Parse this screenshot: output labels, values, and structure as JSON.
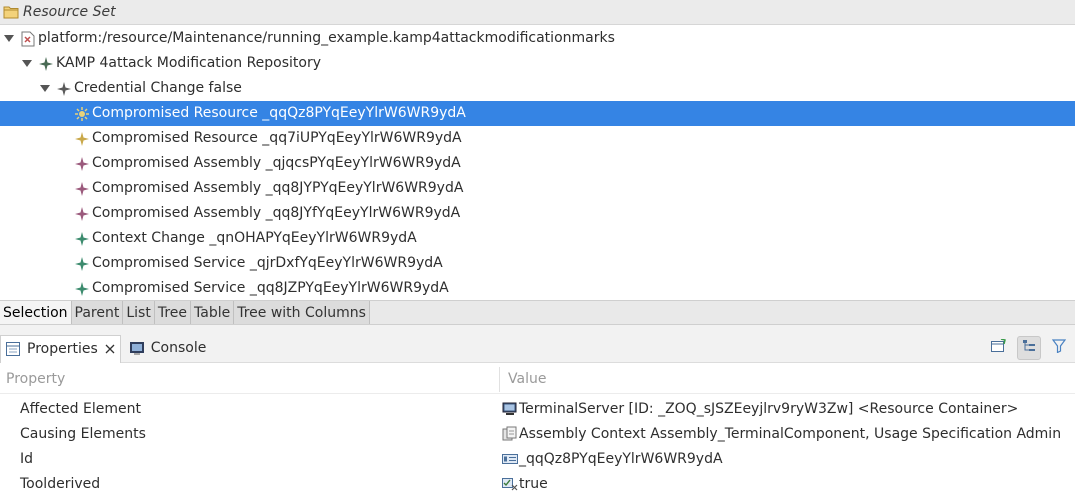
{
  "header": {
    "title": "Resource Set"
  },
  "tree": {
    "root": {
      "label": "platform:/resource/Maintenance/running_example.kamp4attackmodificationmarks"
    },
    "repository": {
      "label": "KAMP 4attack Modification Repository"
    },
    "change": {
      "label": "Credential Change false"
    },
    "items": [
      {
        "label": "Compromised Resource _qqQz8PYqEeyYlrW6WR9ydA",
        "icon": "gear-icon",
        "color": "#c9a84a"
      },
      {
        "label": "Compromised Resource _qq7iUPYqEeyYlrW6WR9ydA",
        "icon": "sparkle-icon",
        "color": "#c9a84a"
      },
      {
        "label": "Compromised Assembly _qjqcsPYqEeyYlrW6WR9ydA",
        "icon": "sparkle-icon",
        "color": "#9b5a7c"
      },
      {
        "label": "Compromised Assembly _qq8JYPYqEeyYlrW6WR9ydA",
        "icon": "sparkle-icon",
        "color": "#9b5a7c"
      },
      {
        "label": "Compromised Assembly _qq8JYfYqEeyYlrW6WR9ydA",
        "icon": "sparkle-icon",
        "color": "#9b5a7c"
      },
      {
        "label": "Context Change _qnOHAPYqEeyYlrW6WR9ydA",
        "icon": "sparkle-icon",
        "color": "#3d8b6e"
      },
      {
        "label": "Compromised Service _qjrDxfYqEeyYlrW6WR9ydA",
        "icon": "sparkle-icon",
        "color": "#3d8b6e"
      },
      {
        "label": "Compromised Service _qq8JZPYqEeyYlrW6WR9ydA",
        "icon": "sparkle-icon",
        "color": "#3d8b6e"
      }
    ]
  },
  "editor_tabs": [
    "Selection",
    "Parent",
    "List",
    "Tree",
    "Table",
    "Tree with Columns"
  ],
  "views": {
    "properties": "Properties",
    "console": "Console"
  },
  "properties": {
    "col_property": "Property",
    "col_value": "Value",
    "rows": [
      {
        "name": "Affected Element",
        "value": "TerminalServer [ID: _ZOQ_sJSZEeyjlrv9ryW3Zw] <Resource Container>",
        "icon": "server-icon"
      },
      {
        "name": "Causing Elements",
        "value": "Assembly Context Assembly_TerminalComponent, Usage Specification Admin",
        "icon": "elements-icon"
      },
      {
        "name": "Id",
        "value": "_qqQz8PYqEeyYlrW6WR9ydA",
        "icon": "id-icon"
      },
      {
        "name": "Toolderived",
        "value": "true",
        "icon": "boolean-icon"
      }
    ]
  },
  "colors": {
    "selection": "#3584e4",
    "accent_blue": "#2f6fb5"
  }
}
